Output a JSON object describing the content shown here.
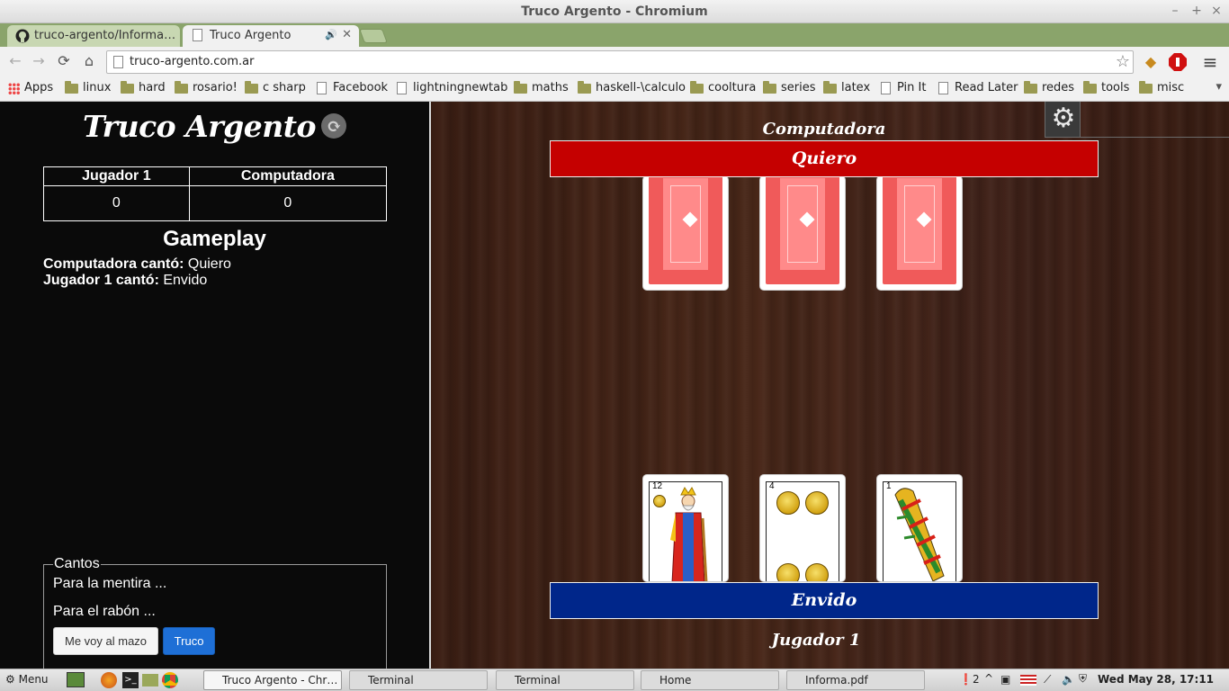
{
  "window": {
    "title": "Truco Argento - Chromium"
  },
  "tabs": [
    {
      "label": "truco-argento/Informa…",
      "icon": "github-icon"
    },
    {
      "label": "Truco Argento",
      "icon": "page-icon",
      "audio": "🔊",
      "close": "✕"
    }
  ],
  "toolbar": {
    "url": "truco-argento.com.ar"
  },
  "bookmarks": [
    {
      "label": "Apps",
      "icon": "apps-icon"
    },
    {
      "label": "linux",
      "icon": "folder-icon"
    },
    {
      "label": "hard",
      "icon": "folder-icon"
    },
    {
      "label": "rosario!",
      "icon": "folder-icon"
    },
    {
      "label": "c sharp",
      "icon": "folder-icon"
    },
    {
      "label": "Facebook",
      "icon": "page-icon"
    },
    {
      "label": "lightningnewtab",
      "icon": "page-icon"
    },
    {
      "label": "maths",
      "icon": "folder-icon"
    },
    {
      "label": "haskell-\\calculo",
      "icon": "folder-icon"
    },
    {
      "label": "cooltura",
      "icon": "folder-icon"
    },
    {
      "label": "series",
      "icon": "folder-icon"
    },
    {
      "label": "latex",
      "icon": "folder-icon"
    },
    {
      "label": "Pin It",
      "icon": "page-icon"
    },
    {
      "label": "Read Later",
      "icon": "page-icon"
    },
    {
      "label": "redes",
      "icon": "folder-icon"
    },
    {
      "label": "tools",
      "icon": "folder-icon"
    },
    {
      "label": "misc",
      "icon": "folder-icon"
    }
  ],
  "game": {
    "title": "Truco Argento",
    "score": {
      "headers": [
        "Jugador 1",
        "Computadora"
      ],
      "values": [
        "0",
        "0"
      ]
    },
    "gameplay_title": "Gameplay",
    "log": [
      {
        "who": "Computadora cantó:",
        "what": "Quiero"
      },
      {
        "who": "Jugador 1 cantó:",
        "what": "Envido"
      }
    ],
    "cantos": {
      "legend": "Cantos",
      "lines": [
        "Para la mentira ...",
        "Para el rabón ..."
      ],
      "buttons": [
        "Me voy al mazo",
        "Truco"
      ]
    },
    "opponent_label": "Computadora",
    "opponent_call": "Quiero",
    "player_label": "Jugador 1",
    "player_call": "Envido",
    "player_cards": [
      {
        "number": "12",
        "suit": "oro"
      },
      {
        "number": "4",
        "suit": "oro"
      },
      {
        "number": "1",
        "suit": "basto"
      }
    ]
  },
  "taskbar": {
    "menu": "Menu",
    "windows": [
      "Truco Argento - Chr…",
      "Terminal",
      "Terminal",
      "Home",
      "Informa.pdf"
    ],
    "tray_badge": "2",
    "clock": "Wed May 28, 17:11"
  }
}
